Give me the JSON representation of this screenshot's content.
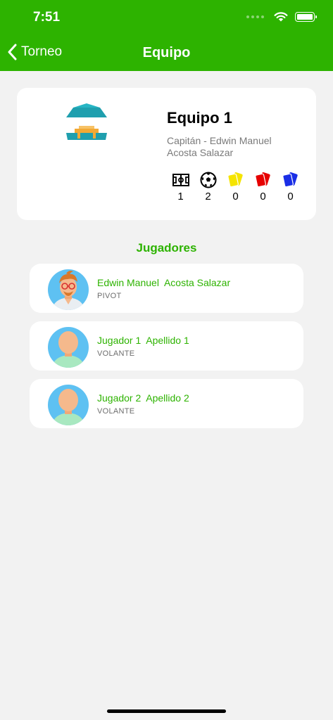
{
  "status_bar": {
    "time": "7:51"
  },
  "nav": {
    "back_label": "Torneo",
    "title": "Equipo"
  },
  "team": {
    "name": "Equipo 1",
    "captain": "Capitán - Edwin Manuel Acosta Salazar",
    "stats": [
      {
        "icon": "field-icon",
        "value": "1"
      },
      {
        "icon": "soccer-ball-icon",
        "value": "2"
      },
      {
        "icon": "yellow-card-icon",
        "value": "0",
        "color": "#f5e400"
      },
      {
        "icon": "red-card-icon",
        "value": "0",
        "color": "#e60000"
      },
      {
        "icon": "blue-card-icon",
        "value": "0",
        "color": "#1a2ee6"
      }
    ]
  },
  "players_title": "Jugadores",
  "players": [
    {
      "name": "Edwin Manuel  Acosta Salazar",
      "position": "PIVOT",
      "avatar": "captain-avatar-icon"
    },
    {
      "name": "Jugador 1  Apellido 1",
      "position": "VOLANTE",
      "avatar": "player-avatar-icon"
    },
    {
      "name": "Jugador 2  Apellido 2",
      "position": "VOLANTE",
      "avatar": "player-avatar-icon"
    }
  ],
  "colors": {
    "primary": "#2db300",
    "background": "#f2f2f2"
  }
}
